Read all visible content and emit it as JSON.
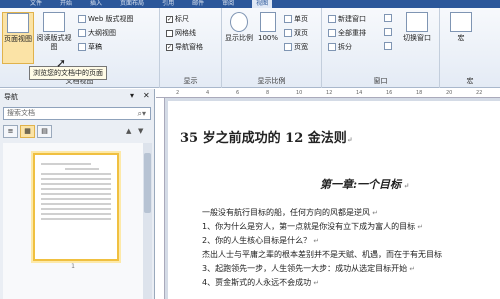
{
  "top_tabs": [
    "文件",
    "开始",
    "插入",
    "页面布局",
    "引用",
    "邮件",
    "审阅",
    "视图"
  ],
  "ribbon": {
    "doc_views": {
      "group_label": "文档视图",
      "page_view": "页面视图",
      "reading_view": "阅读版式视图",
      "web_view": "Web 版式视图",
      "outline": "大纲视图",
      "draft": "草稿"
    },
    "show": {
      "group_label": "显示",
      "ruler": "标尺",
      "gridlines": "网格线",
      "nav_pane": "导航窗格"
    },
    "zoom": {
      "group_label": "显示比例",
      "zoom": "显示比例",
      "percent": "100%",
      "one_page": "单页",
      "two_pages": "双页",
      "page_width": "页宽"
    },
    "window": {
      "group_label": "窗口",
      "new_window": "新建窗口",
      "arrange_all": "全部重排",
      "split": "拆分",
      "switch": "切换窗口"
    },
    "macros": {
      "group_label": "宏",
      "label": "宏"
    }
  },
  "nav": {
    "title": "导航",
    "search_placeholder": "搜索文档",
    "tooltip": "浏览您的文档中的页面",
    "page_number": "1"
  },
  "document": {
    "title": "35 岁之前成功的 12 金法则",
    "chapter": "第一章:一个目标",
    "lines": [
      "一般没有航行目标的船，任何方向的风都是逆风",
      "1、你为什么是穷人，第一点就是你没有立下成为富人的目标",
      "2、你的人生核心目标是什么？",
      "杰出人士与平庸之辈的根本差别并不是天赋、机遇，而在于有无目标",
      "3、起跑领先一步，人生领先一大步：成功从选定目标开始",
      "4、贾金斯式的人永远不会成功"
    ]
  }
}
